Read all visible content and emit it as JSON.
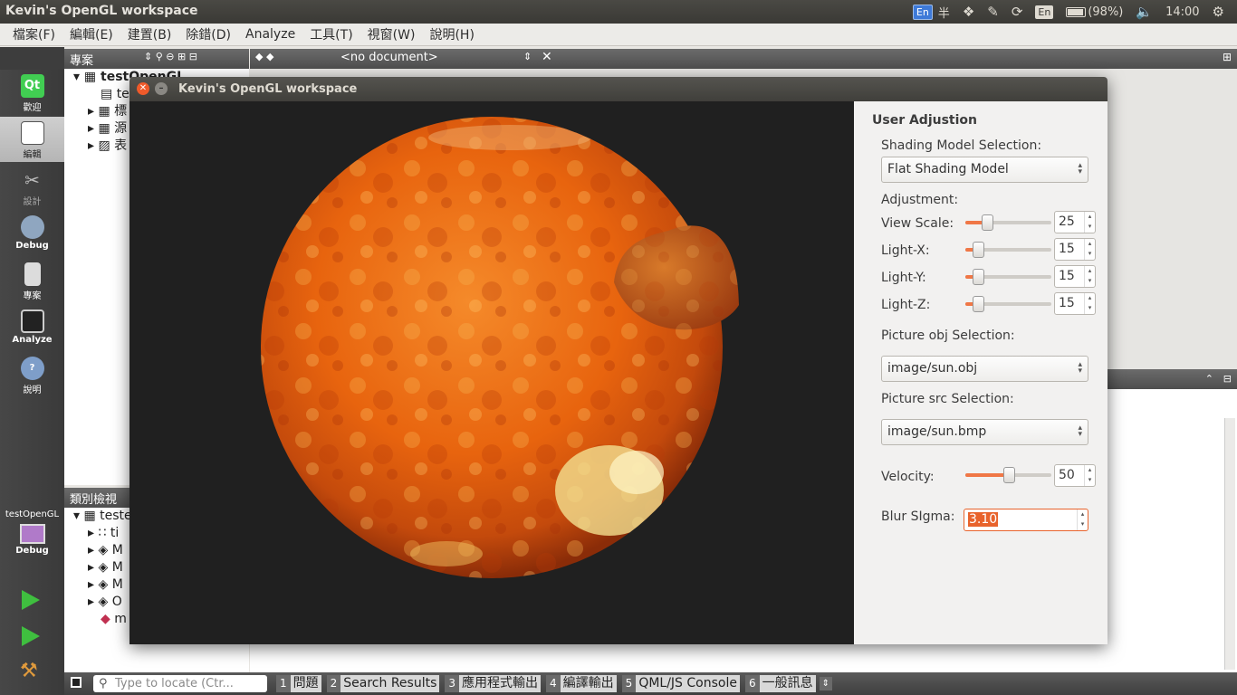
{
  "desktop": {
    "window_title": "Kevin's OpenGL workspace",
    "tray": {
      "input_method": "En",
      "half_width": "半",
      "keyboard": "En",
      "battery": "(98%)",
      "clock": "14:00"
    }
  },
  "menu": [
    "檔案(F)",
    "編輯(E)",
    "建置(B)",
    "除錯(D)",
    "Analyze",
    "工具(T)",
    "視窗(W)",
    "說明(H)"
  ],
  "modes": [
    "歡迎",
    "編輯",
    "設計",
    "Debug",
    "專案",
    "Analyze",
    "說明"
  ],
  "kit": {
    "project": "testOpenGL",
    "config": "Debug"
  },
  "project_panel": {
    "title": "專案",
    "items": [
      "testOpenGL",
      "te",
      "標",
      "源",
      "表"
    ]
  },
  "class_panel": {
    "title": "類別檢視",
    "items": [
      "teste",
      "ti",
      "M",
      "M",
      "M",
      "O",
      "m"
    ]
  },
  "editor": {
    "no_document": "<no document>"
  },
  "locator": {
    "placeholder": "Type to locate (Ctr..."
  },
  "output_tabs": [
    {
      "num": "1",
      "label": "問題"
    },
    {
      "num": "2",
      "label": "Search Results"
    },
    {
      "num": "3",
      "label": "應用程式輸出"
    },
    {
      "num": "4",
      "label": "編譯輸出"
    },
    {
      "num": "5",
      "label": "QML/JS Console"
    },
    {
      "num": "6",
      "label": "一般訊息"
    }
  ],
  "app": {
    "title": "Kevin's OpenGL workspace",
    "panel_title": "User Adjustion",
    "shading_label": "Shading Model Selection:",
    "shading_value": "Flat Shading Model",
    "adjustment_label": "Adjustment:",
    "sliders": [
      {
        "label": "View Scale:",
        "value": "25",
        "fraction": 0.25
      },
      {
        "label": "Light-X:",
        "value": "15",
        "fraction": 0.15
      },
      {
        "label": "Light-Y:",
        "value": "15",
        "fraction": 0.15
      },
      {
        "label": "Light-Z:",
        "value": "15",
        "fraction": 0.15
      }
    ],
    "obj_label": "Picture obj Selection:",
    "obj_value": "image/sun.obj",
    "src_label": "Picture src Selection:",
    "src_value": "image/sun.bmp",
    "velocity": {
      "label": "Velocity:",
      "value": "50",
      "fraction": 0.5
    },
    "blur": {
      "label": "Blur SIgma:",
      "value": "3.10"
    }
  },
  "colors": {
    "accent": "#e8632c",
    "sun_core": "#f26a10",
    "sun_dark": "#a8300a"
  }
}
